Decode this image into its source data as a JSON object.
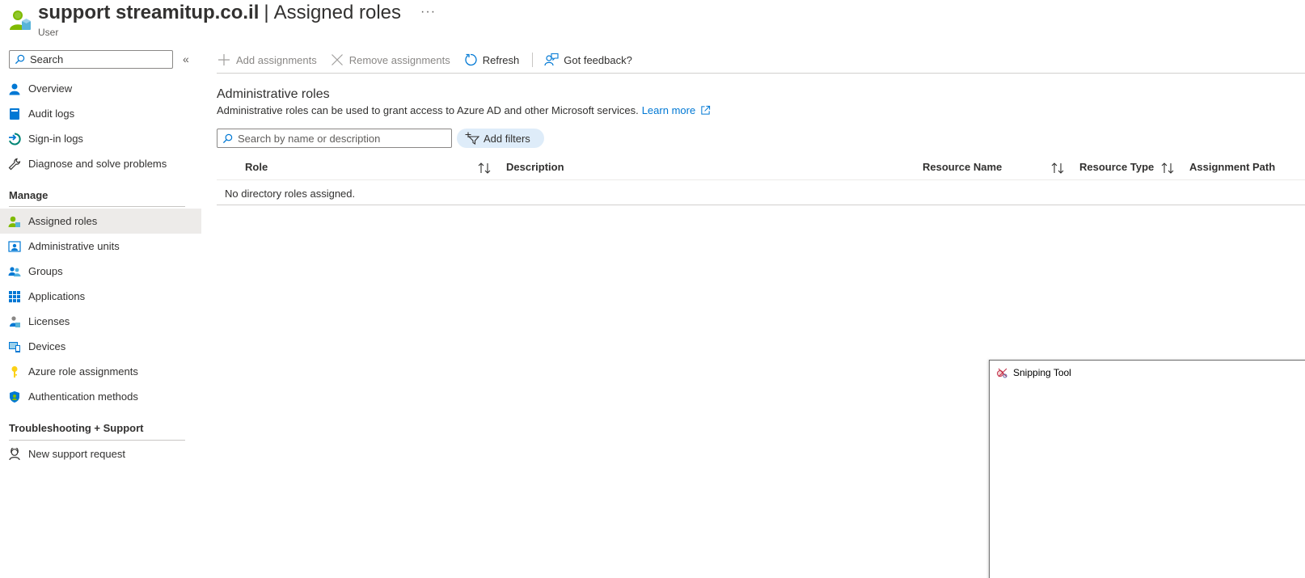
{
  "header": {
    "resource_name": "support streamitup.co.il",
    "separator": "|",
    "page_title": "Assigned roles",
    "more": "···",
    "resource_type": "User"
  },
  "sidebar": {
    "search_placeholder": "Search",
    "collapse": "«",
    "top_items": [
      {
        "label": "Overview",
        "icon": "user-icon"
      },
      {
        "label": "Audit logs",
        "icon": "book-icon"
      },
      {
        "label": "Sign-in logs",
        "icon": "sign-in-icon"
      },
      {
        "label": "Diagnose and solve problems",
        "icon": "wrench-icon"
      }
    ],
    "manage_heading": "Manage",
    "manage_items": [
      {
        "label": "Assigned roles",
        "icon": "assigned-roles-icon",
        "active": true
      },
      {
        "label": "Administrative units",
        "icon": "admin-units-icon"
      },
      {
        "label": "Groups",
        "icon": "groups-icon"
      },
      {
        "label": "Applications",
        "icon": "grid-icon"
      },
      {
        "label": "Licenses",
        "icon": "license-icon"
      },
      {
        "label": "Devices",
        "icon": "device-icon"
      },
      {
        "label": "Azure role assignments",
        "icon": "key-icon"
      },
      {
        "label": "Authentication methods",
        "icon": "shield-icon"
      }
    ],
    "support_heading": "Troubleshooting + Support",
    "support_items": [
      {
        "label": "New support request",
        "icon": "support-person-icon"
      }
    ]
  },
  "toolbar": {
    "add_assignments": "Add assignments",
    "remove_assignments": "Remove assignments",
    "refresh": "Refresh",
    "feedback": "Got feedback?"
  },
  "main": {
    "section_title": "Administrative roles",
    "section_desc": "Administrative roles can be used to grant access to Azure AD and other Microsoft services.",
    "learn_more": "Learn more",
    "search_placeholder": "Search by name or description",
    "add_filters": "Add filters",
    "columns": {
      "role": "Role",
      "description": "Description",
      "resource_name": "Resource Name",
      "resource_type": "Resource Type",
      "assignment_path": "Assignment Path"
    },
    "empty_message": "No directory roles assigned."
  },
  "snipping_tool": {
    "title": "Snipping Tool"
  },
  "colors": {
    "accent": "#0078d4",
    "active_bg": "#edebe9",
    "filter_pill": "#deecf9"
  }
}
